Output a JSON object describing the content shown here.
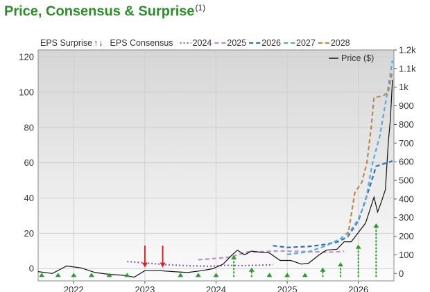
{
  "title": "Price, Consensus & Surprise",
  "title_footnote": "(1)",
  "chart_data": {
    "type": "line",
    "legend": {
      "eps_surprise_label": "EPS Surprise",
      "up_arrow": "↑",
      "down_arrow": "↓",
      "eps_consensus_label": "EPS Consensus",
      "price_label": "Price ($)",
      "placement": "top"
    },
    "x_ticks": [
      "2022",
      "2023",
      "2024",
      "2025",
      "2026"
    ],
    "xlim": [
      2021.5,
      2026.5
    ],
    "y_left": {
      "ticks": [
        "0",
        "20",
        "40",
        "60",
        "80",
        "100",
        "120"
      ],
      "ylim": [
        -7,
        124
      ]
    },
    "y_right": {
      "ticks": [
        "0",
        "100",
        "200",
        "300",
        "400",
        "500",
        "600",
        "700",
        "800",
        "900",
        "1k",
        "1.1k",
        "1.2k"
      ],
      "ylim": [
        -40,
        1200
      ]
    },
    "grid": true,
    "colors": {
      "price": "#111111",
      "2024": "#8e5fb8",
      "2025": "#c08bd1",
      "2026": "#2f6fb5",
      "2027": "#5fa8d8",
      "2028": "#b8894a",
      "surprise_up": "#2e9a2e",
      "surprise_down": "#e02020"
    },
    "consensus": [
      {
        "name": "2024",
        "points": [
          [
            2022.75,
            4
          ],
          [
            2023.0,
            3.2
          ],
          [
            2023.3,
            2.2
          ],
          [
            2023.6,
            1.6
          ],
          [
            2023.9,
            1.3
          ],
          [
            2024.15,
            1.8
          ],
          [
            2024.35,
            1.6
          ],
          [
            2024.6,
            1.9
          ],
          [
            2024.8,
            2.1
          ]
        ]
      },
      {
        "name": "2025",
        "points": [
          [
            2023.75,
            5
          ],
          [
            2024.0,
            5.8
          ],
          [
            2024.2,
            6.5
          ],
          [
            2024.45,
            9.5
          ],
          [
            2024.6,
            9.5
          ],
          [
            2024.85,
            10
          ],
          [
            2025.1,
            9.8
          ],
          [
            2025.4,
            9.5
          ],
          [
            2025.6,
            9.3
          ],
          [
            2025.8,
            9.8
          ]
        ]
      },
      {
        "name": "2026",
        "points": [
          [
            2024.8,
            13
          ],
          [
            2025.0,
            12
          ],
          [
            2025.3,
            12.5
          ],
          [
            2025.5,
            13.5
          ],
          [
            2025.7,
            15
          ],
          [
            2025.85,
            18
          ],
          [
            2026.0,
            27
          ],
          [
            2026.15,
            45
          ],
          [
            2026.25,
            58
          ],
          [
            2026.4,
            60
          ],
          [
            2026.48,
            61
          ]
        ]
      },
      {
        "name": "2027",
        "points": [
          [
            2025.0,
            8
          ],
          [
            2025.3,
            9.5
          ],
          [
            2025.55,
            13
          ],
          [
            2025.75,
            17
          ],
          [
            2025.9,
            22
          ],
          [
            2026.0,
            28
          ],
          [
            2026.1,
            38
          ],
          [
            2026.2,
            60
          ],
          [
            2026.3,
            75
          ],
          [
            2026.4,
            98
          ],
          [
            2026.48,
            118
          ]
        ]
      },
      {
        "name": "2028",
        "points": [
          [
            2025.85,
            18
          ],
          [
            2025.95,
            43
          ],
          [
            2026.05,
            49
          ],
          [
            2026.12,
            60
          ],
          [
            2026.18,
            80
          ],
          [
            2026.22,
            97
          ],
          [
            2026.35,
            98
          ],
          [
            2026.42,
            100
          ],
          [
            2026.48,
            112
          ]
        ]
      }
    ],
    "price": [
      [
        2021.5,
        10
      ],
      [
        2021.7,
        0
      ],
      [
        2021.9,
        40
      ],
      [
        2022.1,
        30
      ],
      [
        2022.3,
        5
      ],
      [
        2022.5,
        -5
      ],
      [
        2022.7,
        -10
      ],
      [
        2022.85,
        -20
      ],
      [
        2023.0,
        15
      ],
      [
        2023.2,
        15
      ],
      [
        2023.4,
        10
      ],
      [
        2023.6,
        5
      ],
      [
        2023.8,
        15
      ],
      [
        2023.95,
        25
      ],
      [
        2024.1,
        50
      ],
      [
        2024.2,
        90
      ],
      [
        2024.3,
        125
      ],
      [
        2024.4,
        100
      ],
      [
        2024.5,
        120
      ],
      [
        2024.6,
        115
      ],
      [
        2024.75,
        110
      ],
      [
        2024.9,
        70
      ],
      [
        2025.05,
        70
      ],
      [
        2025.2,
        50
      ],
      [
        2025.3,
        55
      ],
      [
        2025.45,
        100
      ],
      [
        2025.55,
        125
      ],
      [
        2025.7,
        130
      ],
      [
        2025.8,
        170
      ],
      [
        2025.9,
        170
      ],
      [
        2026.0,
        220
      ],
      [
        2026.1,
        270
      ],
      [
        2026.17,
        350
      ],
      [
        2026.22,
        410
      ],
      [
        2026.27,
        330
      ],
      [
        2026.32,
        380
      ],
      [
        2026.38,
        450
      ],
      [
        2026.42,
        700
      ],
      [
        2026.45,
        830
      ],
      [
        2026.48,
        1040
      ]
    ],
    "surprises": [
      {
        "x": 2021.55,
        "direction": "up",
        "magnitude": 2
      },
      {
        "x": 2021.78,
        "direction": "up",
        "magnitude": 2
      },
      {
        "x": 2022.0,
        "direction": "up",
        "magnitude": 2
      },
      {
        "x": 2022.25,
        "direction": "up",
        "magnitude": 2
      },
      {
        "x": 2022.5,
        "direction": "up",
        "magnitude": 2
      },
      {
        "x": 2022.75,
        "direction": "up",
        "magnitude": 2
      },
      {
        "x": 2023.0,
        "direction": "down",
        "magnitude": 12
      },
      {
        "x": 2023.25,
        "direction": "down",
        "magnitude": 12
      },
      {
        "x": 2023.5,
        "direction": "up",
        "magnitude": 2
      },
      {
        "x": 2023.75,
        "direction": "up",
        "magnitude": 2
      },
      {
        "x": 2024.0,
        "direction": "up",
        "magnitude": 2
      },
      {
        "x": 2024.25,
        "direction": "up",
        "magnitude": 12
      },
      {
        "x": 2024.5,
        "direction": "up",
        "magnitude": 5
      },
      {
        "x": 2024.75,
        "direction": "up",
        "magnitude": 2
      },
      {
        "x": 2025.0,
        "direction": "up",
        "magnitude": 2
      },
      {
        "x": 2025.25,
        "direction": "up",
        "magnitude": 2
      },
      {
        "x": 2025.5,
        "direction": "up",
        "magnitude": 5
      },
      {
        "x": 2025.75,
        "direction": "up",
        "magnitude": 8
      },
      {
        "x": 2026.0,
        "direction": "up",
        "magnitude": 18
      },
      {
        "x": 2026.25,
        "direction": "up",
        "magnitude": 30
      }
    ]
  }
}
